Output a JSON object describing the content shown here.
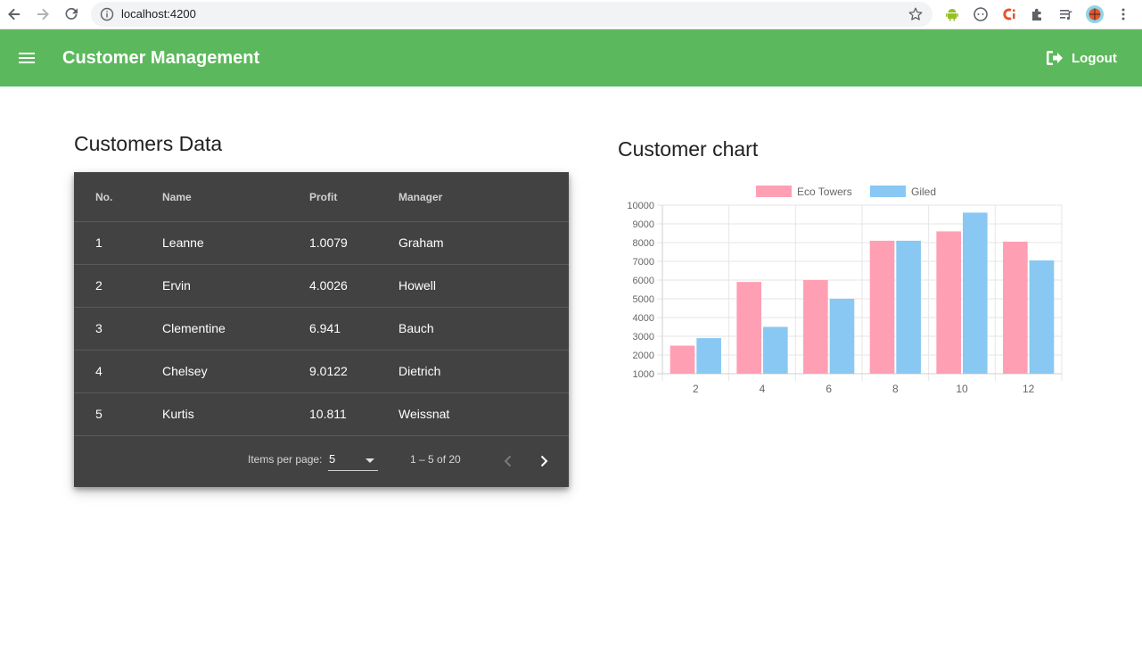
{
  "browser": {
    "url": "localhost:4200"
  },
  "toolbar": {
    "title": "Customer Management",
    "logout_label": "Logout",
    "bg_color": "#5cb85c"
  },
  "table": {
    "title": "Customers Data",
    "headers": [
      "No.",
      "Name",
      "Profit",
      "Manager"
    ],
    "rows": [
      [
        "1",
        "Leanne",
        "1.0079",
        "Graham"
      ],
      [
        "2",
        "Ervin",
        "4.0026",
        "Howell"
      ],
      [
        "3",
        "Clementine",
        "6.941",
        "Bauch"
      ],
      [
        "4",
        "Chelsey",
        "9.0122",
        "Dietrich"
      ],
      [
        "5",
        "Kurtis",
        "10.811",
        "Weissnat"
      ]
    ],
    "paginator": {
      "items_per_page_label": "Items per page:",
      "items_per_page": "5",
      "range_label": "1 – 5 of 20"
    }
  },
  "chart": {
    "title": "Customer chart"
  },
  "chart_data": {
    "type": "bar",
    "categories": [
      "2",
      "4",
      "6",
      "8",
      "10",
      "12"
    ],
    "series": [
      {
        "name": "Eco Towers",
        "color": "#ff9fb3",
        "values": [
          2500,
          5900,
          6000,
          8100,
          8600,
          8050
        ]
      },
      {
        "name": "Giled",
        "color": "#89c8f2",
        "values": [
          2900,
          3500,
          5000,
          8100,
          9600,
          7050
        ]
      }
    ],
    "yticks": [
      1000,
      2000,
      3000,
      4000,
      5000,
      6000,
      7000,
      8000,
      9000,
      10000
    ],
    "ylim": [
      1000,
      10000
    ],
    "grid": true,
    "legend": "top-center"
  }
}
